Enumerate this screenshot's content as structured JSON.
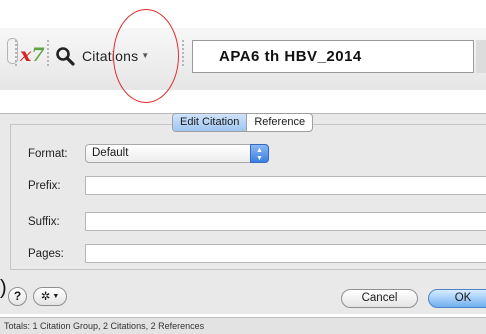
{
  "toolbar": {
    "citations_label": "Citations",
    "style_name": "APA6 th HBV_2014",
    "icons": [
      "x7-endnote-icon",
      "magnifier-icon",
      "chevron-down-icon"
    ]
  },
  "tabs": [
    {
      "label": "Edit Citation",
      "active": true
    },
    {
      "label": "Reference",
      "active": false
    }
  ],
  "form": {
    "format_label": "Format:",
    "format_value": "Default",
    "prefix_label": "Prefix:",
    "prefix_value": "",
    "suffix_label": "Suffix:",
    "suffix_value": "",
    "pages_label": "Pages:",
    "pages_value": ""
  },
  "buttons": {
    "help": "?",
    "cancel": "Cancel",
    "ok": "OK"
  },
  "status": {
    "text": "Totals: 1 Citation Group, 2 Citations, 2 References"
  },
  "colors": {
    "annotation_circle": "#e12b2b",
    "ok_button": "#6fb0f0",
    "active_tab": "#9fc5f2"
  }
}
